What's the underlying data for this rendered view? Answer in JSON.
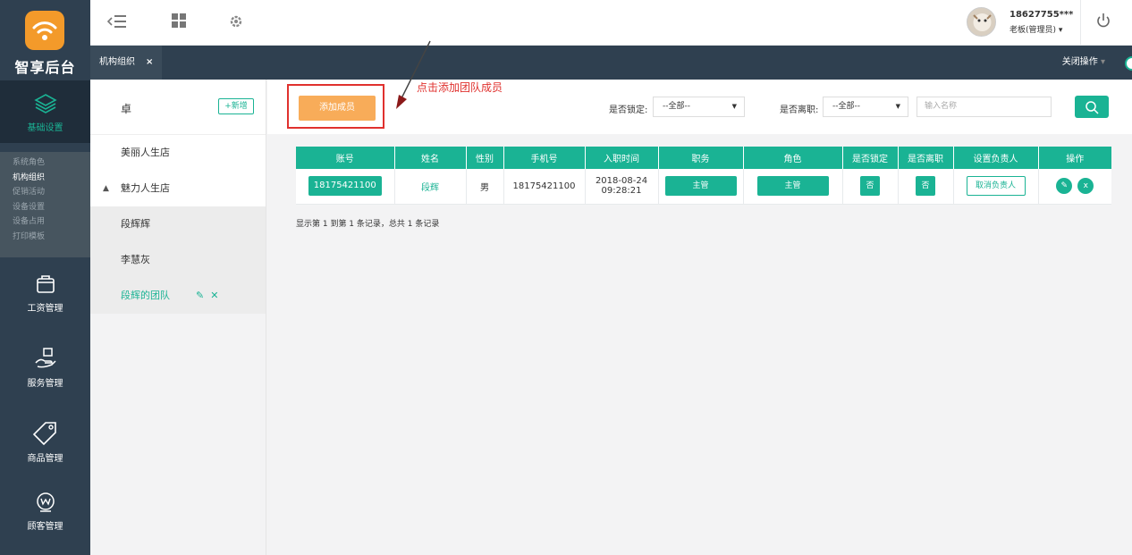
{
  "app": {
    "logo_text": "智享后台",
    "brand_color": "#f39a2a",
    "accent_color": "#1ab394",
    "sidebar_color": "#2f4050"
  },
  "sidebar": {
    "sections": [
      {
        "label": "基础设置",
        "icon": "layers-icon",
        "active": true
      },
      {
        "label": "工资管理",
        "icon": "wallet-icon"
      },
      {
        "label": "服务管理",
        "icon": "hand-service-icon"
      },
      {
        "label": "商品管理",
        "icon": "sale-tag-icon"
      },
      {
        "label": "顾客管理",
        "icon": "crown-icon"
      }
    ],
    "submenu": [
      "系统角色",
      "机构组织",
      "促销活动",
      "设备设置",
      "设备占用",
      "打印模板"
    ],
    "submenu_active": "机构组织"
  },
  "topbar": {
    "user_phone": "18627755***",
    "user_role": "老板(管理员)"
  },
  "tabs": {
    "active_tab": "机构组织",
    "close_ops": "关闭操作"
  },
  "tree": {
    "root": "卓",
    "add_label": "+新增",
    "items": [
      {
        "label": "美丽人生店"
      },
      {
        "label": "魅力人生店"
      },
      {
        "label": "段辉辉"
      },
      {
        "label": "李慧灰"
      },
      {
        "label": "段辉的团队"
      }
    ]
  },
  "toolbar": {
    "add_member_label": "添加成员",
    "hint": "点击添加团队成员",
    "locked_label": "是否锁定:",
    "locked_value": "--全部--",
    "resigned_label": "是否离职:",
    "resigned_value": "--全部--",
    "name_placeholder": "输入名称"
  },
  "table": {
    "headers": [
      "账号",
      "姓名",
      "性别",
      "手机号",
      "入职时间",
      "职务",
      "角色",
      "是否锁定",
      "是否离职",
      "设置负责人",
      "操作"
    ],
    "rows": [
      {
        "account": "18175421100",
        "name": "段辉",
        "gender": "男",
        "phone": "18175421100",
        "join_date": "2018-08-24",
        "join_time": "09:28:21",
        "position": "主管",
        "role": "主管",
        "locked": "否",
        "resigned": "否",
        "manager_action": "取消负责人",
        "delete_label": "x"
      }
    ],
    "records_text": "显示第 1 到第 1 条记录，总共 1 条记录"
  }
}
